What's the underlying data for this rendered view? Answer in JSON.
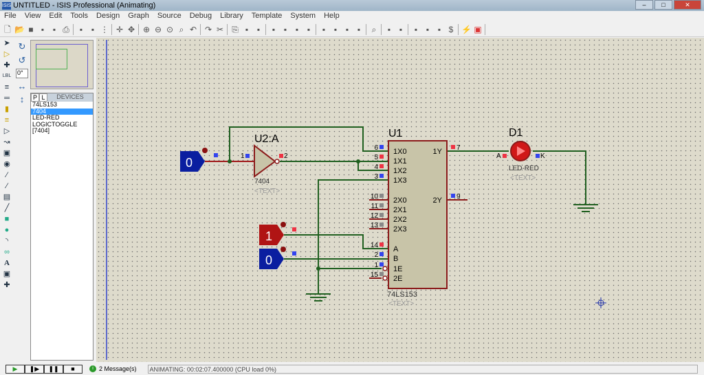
{
  "window": {
    "title": "UNTITLED - ISIS Professional (Animating)",
    "logo": "ISIS",
    "buttons": [
      "minimize",
      "maximize",
      "close"
    ]
  },
  "menu": [
    "File",
    "View",
    "Edit",
    "Tools",
    "Design",
    "Graph",
    "Source",
    "Debug",
    "Library",
    "Template",
    "System",
    "Help"
  ],
  "toolbar_icons": [
    "new-icon",
    "open-icon",
    "save-icon",
    "import-icon",
    "export-icon",
    "print-icon",
    "area-icon",
    "refresh-icon",
    "grid-icon",
    "origin-icon",
    "pan-icon",
    "zoom-in-icon",
    "zoom-out-icon",
    "zoom-all-icon",
    "zoom-area-icon",
    "undo-icon",
    "redo-icon",
    "cut-icon",
    "copy-icon",
    "paste-icon",
    "block-copy-icon",
    "block-move-icon",
    "block-rotate-icon",
    "block-delete-icon",
    "pick-icon",
    "make-device-icon",
    "package-icon",
    "decompose-icon",
    "wire-autoroute-icon",
    "search-icon",
    "property-tool-icon",
    "design-explorer-icon",
    "new-sheet-icon",
    "remove-sheet-icon",
    "exit-parent-icon",
    "bom-icon",
    "erc-icon",
    "netlist-ares-icon"
  ],
  "rotation": {
    "angle": "0°"
  },
  "devices": {
    "tab_p": "P",
    "tab_l": "L",
    "title": "DEVICES",
    "items": [
      "74LS153",
      "7404",
      "LED-RED",
      "LOGICTOGGLE",
      "[7404]"
    ],
    "selected": 1
  },
  "schematic": {
    "toggle_a": {
      "value": "0",
      "state_color": "#0a1ea0"
    },
    "toggle_b": {
      "value": "1",
      "state_color": "#b01414"
    },
    "toggle_c": {
      "value": "0",
      "state_color": "#0a1ea0"
    },
    "inverter": {
      "ref": "U2:A",
      "part": "7404",
      "text": "<TEXT>",
      "pin_in": "1",
      "pin_out": "2"
    },
    "mux": {
      "ref": "U1",
      "part": "74LS153",
      "text": "<TEXT>",
      "left_pins": [
        {
          "num": "6",
          "name": "1X0"
        },
        {
          "num": "5",
          "name": "1X1"
        },
        {
          "num": "4",
          "name": "1X2"
        },
        {
          "num": "3",
          "name": "1X3"
        },
        {
          "num": "10",
          "name": "2X0"
        },
        {
          "num": "11",
          "name": "2X1"
        },
        {
          "num": "12",
          "name": "2X2"
        },
        {
          "num": "13",
          "name": "2X3"
        },
        {
          "num": "14",
          "name": "A"
        },
        {
          "num": "2",
          "name": "B"
        },
        {
          "num": "1",
          "name": "1E"
        },
        {
          "num": "15",
          "name": "2E"
        }
      ],
      "right_pins": [
        {
          "num": "7",
          "name": "1Y"
        },
        {
          "num": "9",
          "name": "2Y"
        }
      ]
    },
    "led": {
      "ref": "D1",
      "part": "LED-RED",
      "text": "<TEXT>",
      "pin_a": "A",
      "pin_k": "K",
      "lit": true
    },
    "colors": {
      "wire_low": "#1f5f1f",
      "wire_high": "#a01818",
      "component_fill": "#c8c4a8",
      "outline": "#8b1a1a"
    }
  },
  "simulation": {
    "controls": [
      "play",
      "step",
      "pause",
      "stop"
    ],
    "messages": "2 Message(s)",
    "status": "ANIMATING: 00:02:07.400000 (CPU load 0%)"
  }
}
